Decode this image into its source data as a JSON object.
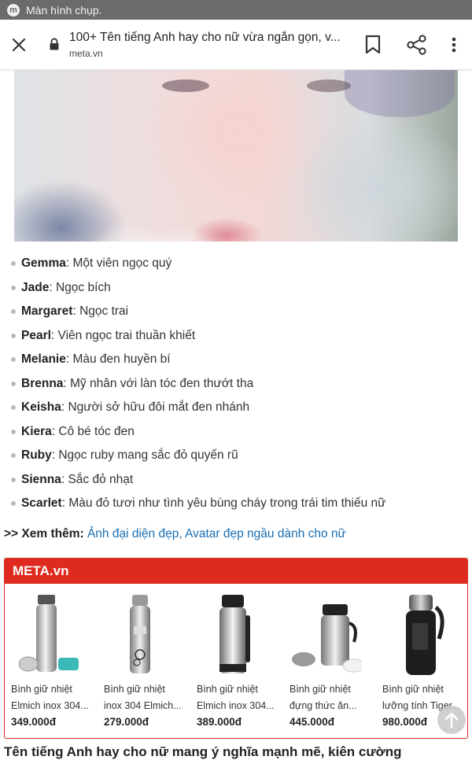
{
  "status_bar": {
    "app_icon_letter": "m",
    "text": "Màn hình chụp."
  },
  "toolbar": {
    "title": "100+ Tên tiếng Anh hay cho nữ vừa ngắn gọn, v...",
    "domain": "meta.vn",
    "icons": [
      "close-icon",
      "lock-icon",
      "bookmark-icon",
      "share-icon",
      "more-vert-icon"
    ]
  },
  "names": [
    {
      "name": "Gemma",
      "meaning": ": Một viên ngọc quý"
    },
    {
      "name": "Jade",
      "meaning": ": Ngọc bích"
    },
    {
      "name": "Margaret",
      "meaning": ": Ngọc trai"
    },
    {
      "name": "Pearl",
      "meaning": ": Viên ngọc trai thuần khiết"
    },
    {
      "name": "Melanie",
      "meaning": ": Màu đen huyền bí"
    },
    {
      "name": "Brenna",
      "meaning": ": Mỹ nhân với làn tóc đen thướt tha"
    },
    {
      "name": "Keisha",
      "meaning": ": Người sở hữu đôi mắt đen nhánh"
    },
    {
      "name": "Kiera",
      "meaning": ": Cô bé tóc đen"
    },
    {
      "name": "Ruby",
      "meaning": ": Ngọc ruby mang sắc đỏ quyến rũ"
    },
    {
      "name": "Sienna",
      "meaning": ": Sắc đỏ nhạt"
    },
    {
      "name": "Scarlet",
      "meaning": ": Màu đỏ tươi như tình yêu bùng cháy trong trái tim thiếu nữ"
    }
  ],
  "see_more": {
    "label": ">> Xem thêm:",
    "link_text": "Ảnh đại diện đẹp, Avatar đẹp ngầu dành cho nữ"
  },
  "promo": {
    "brand": "META.vn",
    "brand_color": "#de2a1f",
    "products": [
      {
        "line1": "Bình giữ nhiệt",
        "line2": "Elmich inox 304...",
        "price": "349.000đ"
      },
      {
        "line1": "Bình giữ nhiệt",
        "line2": "inox 304 Elmich...",
        "price": "279.000đ"
      },
      {
        "line1": "Bình giữ nhiệt",
        "line2": "Elmich inox 304...",
        "price": "389.000đ"
      },
      {
        "line1": "Bình giữ nhiệt",
        "line2": "đựng thức ăn...",
        "price": "445.000đ"
      },
      {
        "line1": "Bình giữ nhiệt",
        "line2": "lưỡng tính Tiger...",
        "price": "980.000đ"
      }
    ]
  },
  "bottom_text": "Tên tiếng Anh hay cho nữ mang ý nghĩa mạnh mẽ, kiên cường"
}
